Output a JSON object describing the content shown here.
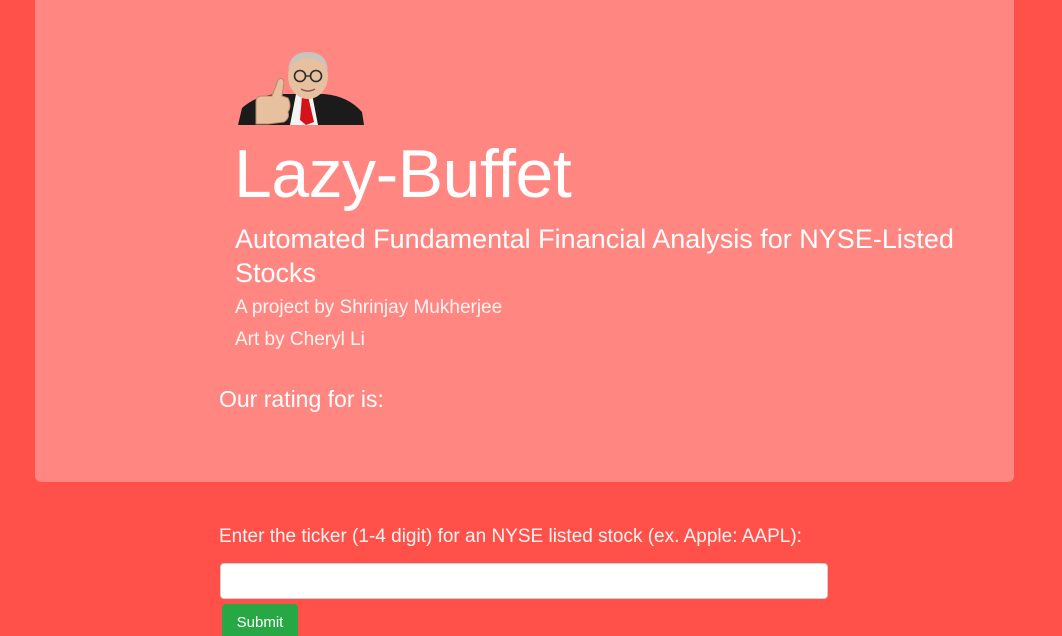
{
  "header": {
    "title": "Lazy-Buffet",
    "subtitle": "Automated Fundamental Financial Analysis for NYSE-Listed Stocks",
    "byline_project": "A project by Shrinjay Mukherjee",
    "byline_art": "Art by Cheryl Li",
    "mascot_icon": "buffett-thumbs-up-icon"
  },
  "result": {
    "rating_text": "Our rating for is:"
  },
  "form": {
    "prompt": "Enter the ticker (1-4 digit) for an NYSE listed stock (ex. Apple: AAPL):",
    "ticker_value": "",
    "submit_label": "Submit"
  },
  "colors": {
    "background": "#ff5149",
    "jumbotron": "#ff8681",
    "submit": "#28a745"
  }
}
